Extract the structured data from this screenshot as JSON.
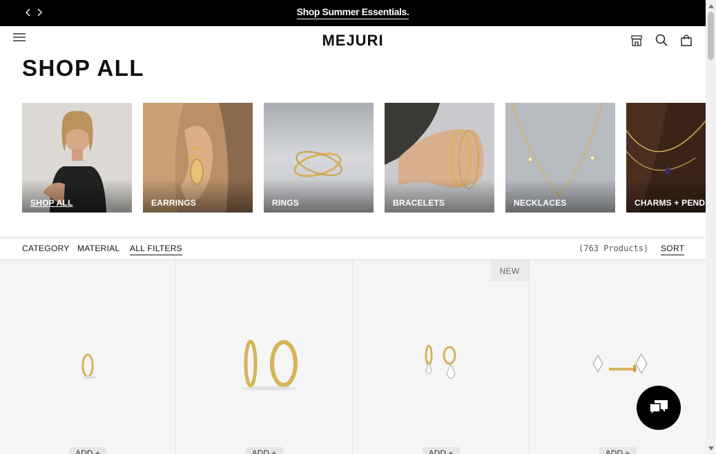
{
  "announcement": {
    "message": "Shop Summer Essentials.",
    "prev_icon": "chevron-left-icon",
    "next_icon": "chevron-right-icon"
  },
  "header": {
    "logo": "MEJURI",
    "icons": [
      "menu-icon",
      "store-icon",
      "search-icon",
      "bag-icon"
    ]
  },
  "page_title": "SHOP ALL",
  "categories": [
    {
      "label": "SHOP ALL",
      "active": true
    },
    {
      "label": "EARRINGS"
    },
    {
      "label": "RINGS"
    },
    {
      "label": "BRACELETS"
    },
    {
      "label": "NECKLACES"
    },
    {
      "label": "CHARMS + PENDANTS"
    }
  ],
  "filters": {
    "category": "CATEGORY",
    "material": "MATERIAL",
    "all_filters": "ALL FILTERS",
    "count": "(763 Products)",
    "sort": "SORT"
  },
  "products": [
    {
      "badge": "",
      "add_label": "ADD +"
    },
    {
      "badge": "",
      "add_label": "ADD +"
    },
    {
      "badge": "NEW",
      "add_label": "ADD +"
    },
    {
      "badge": "",
      "add_label": "ADD +"
    }
  ],
  "chat": {
    "icon": "chat-icon"
  },
  "colors": {
    "gold": "#d8b25a",
    "black": "#000000",
    "card_bg": "#f5f5f5"
  }
}
